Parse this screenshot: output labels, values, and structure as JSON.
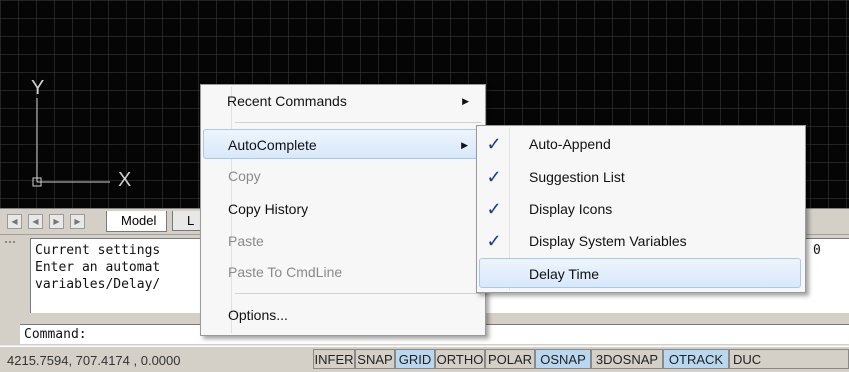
{
  "ucs_icon": {
    "y_label": "Y",
    "x_label": "X"
  },
  "layout_tabs": {
    "model": "Model",
    "layout_partial": "L"
  },
  "command_history": {
    "lines": [
      "Current settings",
      "Enter an automat",
      "variables/Delay/"
    ],
    "right_fragment": "0"
  },
  "command_prompt": "Command:",
  "status_bar": {
    "coordinates": "4215.7594, 707.4174 , 0.0000",
    "buttons": [
      {
        "label": "INFER",
        "on": false
      },
      {
        "label": "SNAP",
        "on": false
      },
      {
        "label": "GRID",
        "on": true
      },
      {
        "label": "ORTHO",
        "on": false
      },
      {
        "label": "POLAR",
        "on": false
      },
      {
        "label": "OSNAP",
        "on": true
      },
      {
        "label": "3DOSNAP",
        "on": false
      },
      {
        "label": "OTRACK",
        "on": true
      },
      {
        "label": "DUC",
        "on": false
      }
    ]
  },
  "context_menu": {
    "items": [
      {
        "label": "Recent Commands",
        "submenu": true,
        "enabled": true
      },
      {
        "label": "AutoComplete",
        "submenu": true,
        "enabled": true,
        "highlighted": true
      },
      {
        "label": "Copy",
        "enabled": false
      },
      {
        "label": "Copy History",
        "enabled": true
      },
      {
        "label": "Paste",
        "enabled": false
      },
      {
        "label": "Paste To CmdLine",
        "enabled": false
      },
      {
        "label": "Options...",
        "enabled": true
      }
    ]
  },
  "autocomplete_submenu": {
    "items": [
      {
        "label": "Auto-Append",
        "checked": true
      },
      {
        "label": "Suggestion List",
        "checked": true
      },
      {
        "label": "Display Icons",
        "checked": true
      },
      {
        "label": "Display System Variables",
        "checked": true
      },
      {
        "label": "Delay Time",
        "checked": false,
        "highlighted": true
      }
    ]
  },
  "colors": {
    "canvas": "#050505",
    "status_on": "#b9d8f0",
    "menu_highlight": "#d8e8fa",
    "check": "#1a3a8a"
  }
}
